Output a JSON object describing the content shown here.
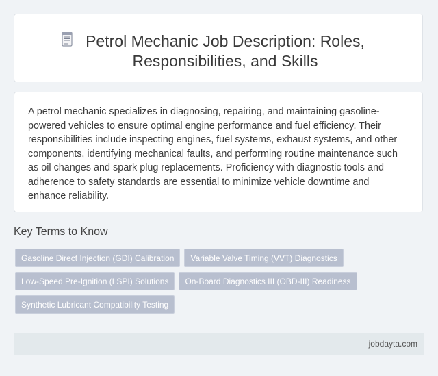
{
  "header": {
    "icon": "document-icon",
    "title": "Petrol Mechanic Job Description: Roles, Responsibilities, and Skills"
  },
  "description": "A petrol mechanic specializes in diagnosing, repairing, and maintaining gasoline-powered vehicles to ensure optimal engine performance and fuel efficiency. Their responsibilities include inspecting engines, fuel systems, exhaust systems, and other components, identifying mechanical faults, and performing routine maintenance such as oil changes and spark plug replacements. Proficiency with diagnostic tools and adherence to safety standards are essential to minimize vehicle downtime and enhance reliability.",
  "key_terms": {
    "heading": "Key Terms to Know",
    "tags": [
      "Gasoline Direct Injection (GDI) Calibration",
      "Variable Valve Timing (VVT) Diagnostics",
      "Low-Speed Pre-Ignition (LSPI) Solutions",
      "On-Board Diagnostics III (OBD-III) Readiness",
      "Synthetic Lubricant Compatibility Testing"
    ]
  },
  "footer": {
    "site": "jobdayta.com"
  },
  "colors": {
    "background": "#f0f3f6",
    "tag": "#b8bfcf",
    "footer": "#e3e9ec"
  }
}
